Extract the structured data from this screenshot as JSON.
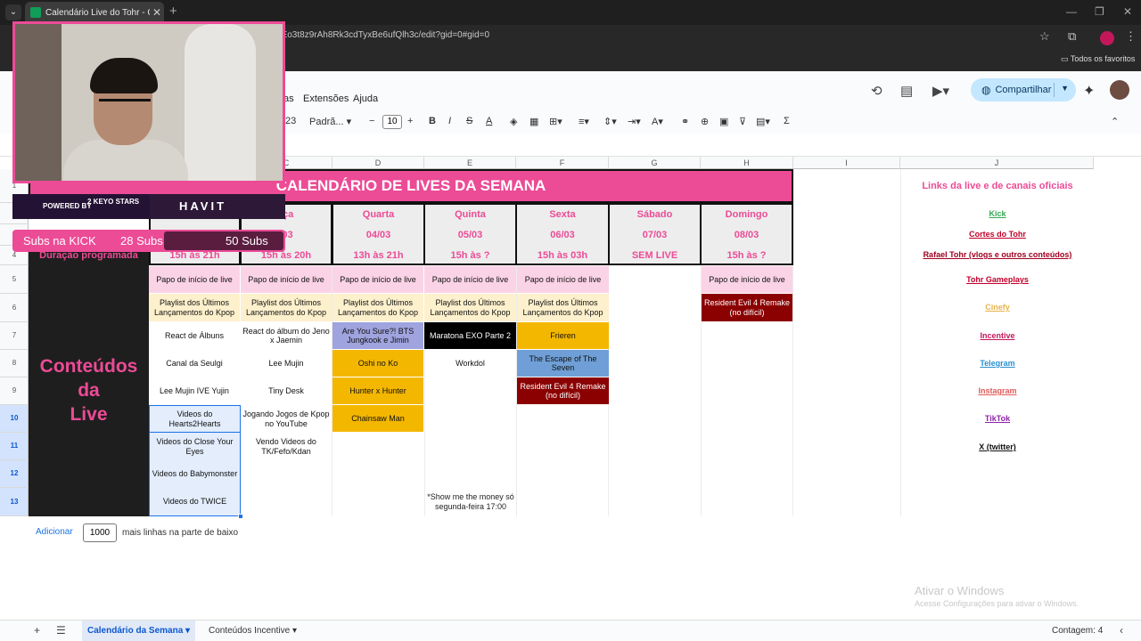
{
  "browser": {
    "tab_title": "Calendário Live do Tohr - Goog",
    "tab_close": "✕",
    "url": "hEo3t8z9rAh8Rk3cdTyxBe6ufQlh3c/edit?gid=0#gid=0",
    "bookmarks_label": "Todos os favoritos"
  },
  "menu": {
    "items": [
      "as",
      "Extensões",
      "Ajuda"
    ]
  },
  "share": {
    "label": "Compartilhar"
  },
  "toolbar": {
    "format_num": "23",
    "font": "Padrã...",
    "font_size": "10"
  },
  "columns": [
    "C",
    "D",
    "E",
    "F",
    "G",
    "H",
    "I",
    "J"
  ],
  "rows": [
    "1",
    "2",
    "3",
    "4",
    "5",
    "6",
    "7",
    "8",
    "9",
    "10",
    "11",
    "12",
    "13"
  ],
  "sheet": {
    "title": "CALENDÁRIO DE LIVES DA SEMANA",
    "days": [
      {
        "name": "rça",
        "date": "/03",
        "time": "15h às 20h"
      },
      {
        "name": "Quarta",
        "date": "04/03",
        "time": "13h às 21h"
      },
      {
        "name": "Quinta",
        "date": "05/03",
        "time": "15h às ?"
      },
      {
        "name": "Sexta",
        "date": "06/03",
        "time": "15h às 03h"
      },
      {
        "name": "Sábado",
        "date": "07/03",
        "time": "SEM LIVE"
      },
      {
        "name": "Domingo",
        "date": "08/03",
        "time": "15h às ?"
      }
    ],
    "partial_time": "15h às 21h",
    "duration_label": "Duração programada",
    "contents_label": [
      "Conteúdos",
      "da",
      "Live"
    ],
    "cells": {
      "r5_c": "Papo de início de live",
      "r5_d": "Papo de início de live",
      "r5_e": "Papo de início de live",
      "r5_f": "Papo de início de live",
      "r5_g": "Papo de início de live",
      "r5_i": "Papo de início de live",
      "r6_c": "Playlist dos Últimos Lançamentos do Kpop",
      "r6_d": "Playlist dos Últimos Lançamentos do Kpop",
      "r6_e": "Playlist dos Últimos Lançamentos do Kpop",
      "r6_f": "Playlist dos Últimos Lançamentos do Kpop",
      "r6_g": "Playlist dos Últimos Lançamentos do Kpop",
      "r6_i": "Resident Evil 4 Remake (no difícil)",
      "r7_c": "React de Álbuns",
      "r7_d": "React do álbum do Jeno x Jaemin",
      "r7_e": "Are You Sure?! BTS Jungkook e Jimin",
      "r7_f": "Maratona EXO Parte 2",
      "r7_g": "Frieren",
      "r8_c": "Canal da Seulgi",
      "r8_d": "Lee Mujin",
      "r8_e": "Oshi no Ko",
      "r8_f": "Workdol",
      "r8_g": "The Escape of The Seven",
      "r9_c": "Lee Mujin IVE Yujin",
      "r9_d": "Tiny Desk",
      "r9_e": "Hunter x Hunter",
      "r9_g": "Resident Evil 4 Remake (no difícil)",
      "r10_c": "Videos do Hearts2Hearts",
      "r10_d": "Jogando Jogos de Kpop no YouTube",
      "r10_e": "Chainsaw Man",
      "r11_c": "Videos do Close Your Eyes",
      "r11_d": "Vendo Videos do TK/Fefo/Kdan",
      "r12_c": "Videos do Babymonster",
      "r13_c": "Videos do TWICE"
    },
    "note": "*Show me the money só segunda-feira 17:00",
    "links_title": "Links da live e de canais oficiais",
    "links": [
      {
        "label": "Kick",
        "color": "#34a853"
      },
      {
        "label": "Cortes do Tohr",
        "color": "#c0002a"
      },
      {
        "label": "Rafael Tohr (vlogs e outros conteúdos)",
        "color": "#a00020"
      },
      {
        "label": "Tohr Gameplays",
        "color": "#c0002a"
      },
      {
        "label": "Cinefy",
        "color": "#e8b34a"
      },
      {
        "label": "Incentive",
        "color": "#c2185b"
      },
      {
        "label": "Telegram",
        "color": "#2a8fd0"
      },
      {
        "label": "Instagram",
        "color": "#e05a5a"
      },
      {
        "label": "TikTok",
        "color": "#8e24aa"
      },
      {
        "label": "X (twitter)",
        "color": "#111111"
      }
    ]
  },
  "addrows": {
    "button": "Adicionar",
    "value": "1000",
    "text": "mais linhas na parte de baixo"
  },
  "watermark": {
    "title": "Ativar o Windows",
    "subtitle": "Acesse Configurações para ativar o Windows."
  },
  "sheet_tabs": {
    "active": "Calendário da Semana",
    "other": "Conteúdos Incentive",
    "count": "Contagem: 4"
  },
  "overlay": {
    "powered": "POWERED BY",
    "keyo": "2 KEYO STARS",
    "havit": "HAVIT",
    "subs_label": "Subs na KICK",
    "subs_current": "28 Subs",
    "subs_goal": "50 Subs"
  },
  "colors": {
    "accent": "#ec4b96",
    "dark": "#1e1e1e"
  }
}
